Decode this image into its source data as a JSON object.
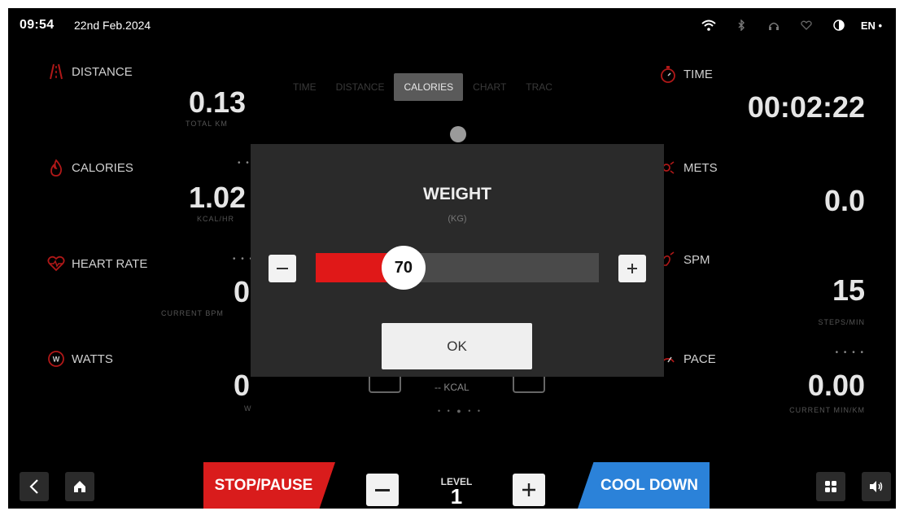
{
  "status": {
    "time": "09:54",
    "date": "22nd Feb.2024",
    "language": "EN"
  },
  "left_metrics": [
    {
      "label": "DISTANCE",
      "value": "0.13",
      "sub": "TOTAL KM"
    },
    {
      "label": "CALORIES",
      "value": "1.02",
      "sub": "KCAL/HR"
    },
    {
      "label": "HEART RATE",
      "value": "0",
      "sub": "CURRENT BPM"
    },
    {
      "label": "WATTS",
      "value": "0",
      "sub": "W"
    }
  ],
  "right_metrics": [
    {
      "label": "TIME",
      "value": "00:02:22"
    },
    {
      "label": "METS",
      "value": "0.0"
    },
    {
      "label": "SPM",
      "value": "15",
      "sub": "STEPS/MIN"
    },
    {
      "label": "PACE",
      "value": "0.00",
      "sub": "CURRENT MIN/KM"
    }
  ],
  "tabs": [
    "TIME",
    "DISTANCE",
    "CALORIES",
    "CHART",
    "TRAC"
  ],
  "active_tab": "CALORIES",
  "center": {
    "kcal_label": "-- KCAL"
  },
  "dialog": {
    "title": "WEIGHT",
    "unit": "(KG)",
    "value": "70",
    "slider_fraction": 0.31,
    "ok_label": "OK"
  },
  "bottom": {
    "stop_label": "STOP/PAUSE",
    "level_label": "LEVEL",
    "level_value": "1",
    "cool_label": "COOL DOWN"
  },
  "colors": {
    "accent_red": "#d91c1c",
    "accent_blue": "#2b82d9",
    "slider_red": "#e01818"
  },
  "icons": [
    "wifi-icon",
    "bluetooth-icon",
    "headphones-icon",
    "heart-icon",
    "contrast-icon",
    "back-icon",
    "home-icon",
    "apps-icon",
    "volume-icon"
  ]
}
